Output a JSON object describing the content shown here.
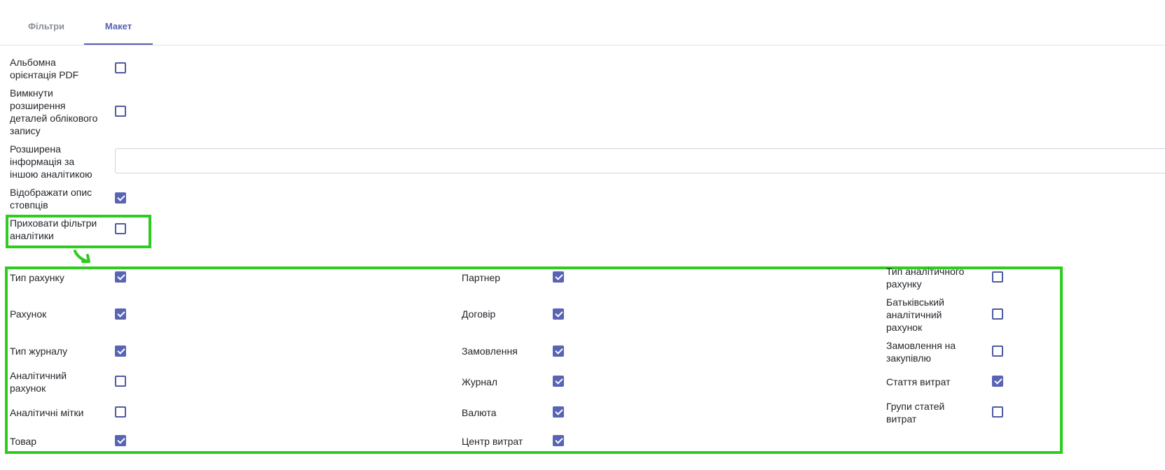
{
  "tabs": [
    {
      "label": "Фільтри",
      "active": false
    },
    {
      "label": "Макет",
      "active": true
    }
  ],
  "settings": [
    {
      "label": "Альбомна орієнтація PDF",
      "checked": false
    },
    {
      "label": "Вимкнути розширення деталей облікового запису",
      "checked": false
    },
    {
      "label": "Розширена інформація за іншою аналітикою",
      "value": ""
    },
    {
      "label": "Відображати опис стовпців",
      "checked": true
    },
    {
      "label": "Приховати фільтри аналітики",
      "checked": false
    }
  ],
  "filters": {
    "col1": [
      {
        "label": "Тип рахунку",
        "checked": true
      },
      {
        "label": "Рахунок",
        "checked": true
      },
      {
        "label": "Тип журналу",
        "checked": true
      },
      {
        "label": "Аналітичний рахунок",
        "checked": false
      },
      {
        "label": "Аналітичні мітки",
        "checked": false
      },
      {
        "label": "Товар",
        "checked": true
      }
    ],
    "col2": [
      {
        "label": "Партнер",
        "checked": true
      },
      {
        "label": "Договір",
        "checked": true
      },
      {
        "label": "Замовлення",
        "checked": true
      },
      {
        "label": "Журнал",
        "checked": true
      },
      {
        "label": "Валюта",
        "checked": true
      },
      {
        "label": "Центр витрат",
        "checked": true
      }
    ],
    "col3": [
      {
        "label": "Тип аналітичного рахунку",
        "checked": false
      },
      {
        "label": "Батьківський аналітичний рахунок",
        "checked": false
      },
      {
        "label": "Замовлення на закупівлю",
        "checked": false
      },
      {
        "label": "Стаття витрат",
        "checked": true
      },
      {
        "label": "Групи статей витрат",
        "checked": false
      }
    ]
  },
  "colors": {
    "accent": "#5964b5",
    "highlight": "#2ecc1f"
  }
}
